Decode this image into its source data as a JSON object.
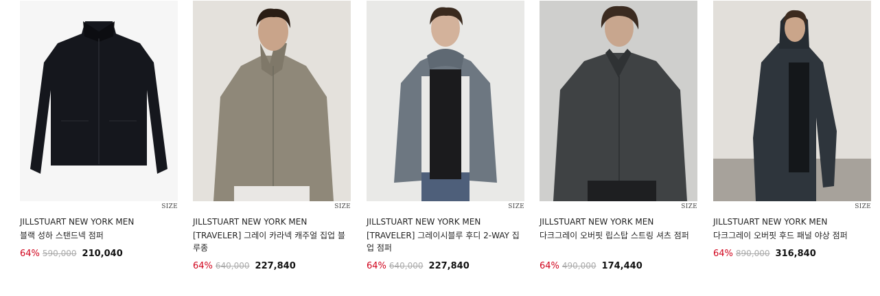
{
  "size_label": "SIZE",
  "products": [
    {
      "brand": "JILLSTUART NEW YORK MEN",
      "name": "블랙 성하 스탠드넥 점퍼",
      "discount": "64%",
      "original_price": "590,000",
      "sale_price": "210,040",
      "photo": "black-stand-collar-jacket-flat"
    },
    {
      "brand": "JILLSTUART NEW YORK MEN",
      "name": "[TRAVELER] 그레이 카라넥 캐주얼 집업 블루종",
      "discount": "64%",
      "original_price": "640,000",
      "sale_price": "227,840",
      "photo": "model-gray-blouson"
    },
    {
      "brand": "JILLSTUART NEW YORK MEN",
      "name": "[TRAVELER] 그레이시블루 후디 2-WAY 집업 점퍼",
      "discount": "64%",
      "original_price": "640,000",
      "sale_price": "227,840",
      "photo": "model-grayish-blue-hoodie"
    },
    {
      "brand": "JILLSTUART NEW YORK MEN",
      "name": "다크그레이 오버핏 립스탑 스트링 셔츠 점퍼",
      "discount": "64%",
      "original_price": "490,000",
      "sale_price": "174,440",
      "photo": "model-dark-gray-shirt-jacket"
    },
    {
      "brand": "JILLSTUART NEW YORK MEN",
      "name": "다크그레이 오버핏 후드 패널 야상 점퍼",
      "discount": "64%",
      "original_price": "890,000",
      "sale_price": "316,840",
      "photo": "model-dark-gray-hooded-parka"
    }
  ]
}
